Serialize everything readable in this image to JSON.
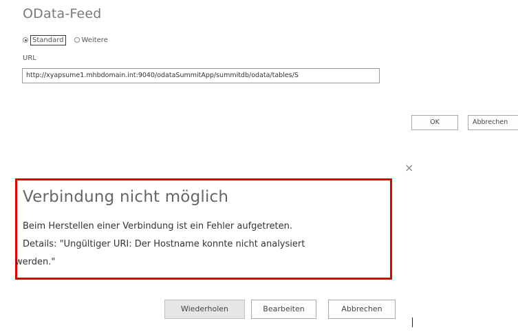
{
  "odata_dialog": {
    "title": "OData-Feed",
    "radio_options": [
      "Standard",
      "Weitere"
    ],
    "selected_option": "Standard",
    "url_label": "URL",
    "url_value": "http://xyapsume1.mhbdomain.int:9040/odataSummitApp/summitdb/odata/tables/S",
    "ok_label": "OK",
    "cancel_label": "Abbrechen"
  },
  "error_dialog": {
    "close_glyph": "×",
    "title": "Verbindung nicht möglich",
    "message_line1": "Beim Herstellen einer Verbindung ist ein Fehler aufgetreten.",
    "message_line2": "Details: \"Ungültiger URI: Der Hostname konnte nicht analysiert",
    "message_line3": "werden.\"",
    "retry_label": "Wiederholen",
    "edit_label": "Bearbeiten",
    "cancel_label": "Abbrechen",
    "highlight_color": "#e00000"
  }
}
